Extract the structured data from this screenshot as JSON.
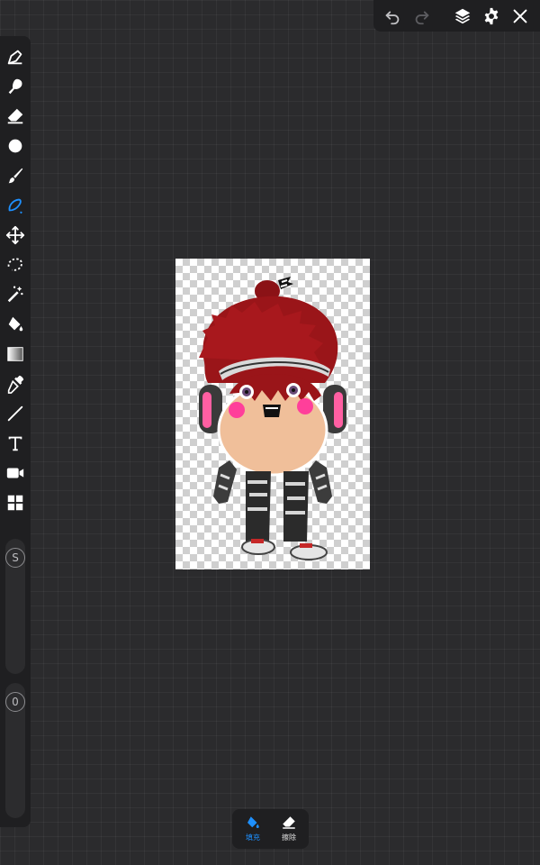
{
  "accent_color": "#1e90ff",
  "top_toolbar": {
    "items": [
      "undo-icon",
      "redo-icon",
      "layers-icon",
      "settings-icon",
      "close-icon"
    ]
  },
  "left_toolbar": {
    "tools": [
      "pen-icon",
      "smudge-icon",
      "eraser-icon",
      "circle-icon",
      "brush-icon",
      "lasso-pen-icon",
      "move-icon",
      "lasso-select-icon",
      "magic-wand-icon",
      "fill-bucket-icon",
      "gradient-icon",
      "eyedropper-icon",
      "line-icon",
      "text-icon",
      "video-icon",
      "grid-icon"
    ],
    "active_tool": "lasso-pen-icon",
    "size_slider_label": "S",
    "opacity_slider_label": "0"
  },
  "bottom_toolbar": {
    "fill_label": "填充",
    "erase_label": "擦除",
    "active": "fill"
  }
}
